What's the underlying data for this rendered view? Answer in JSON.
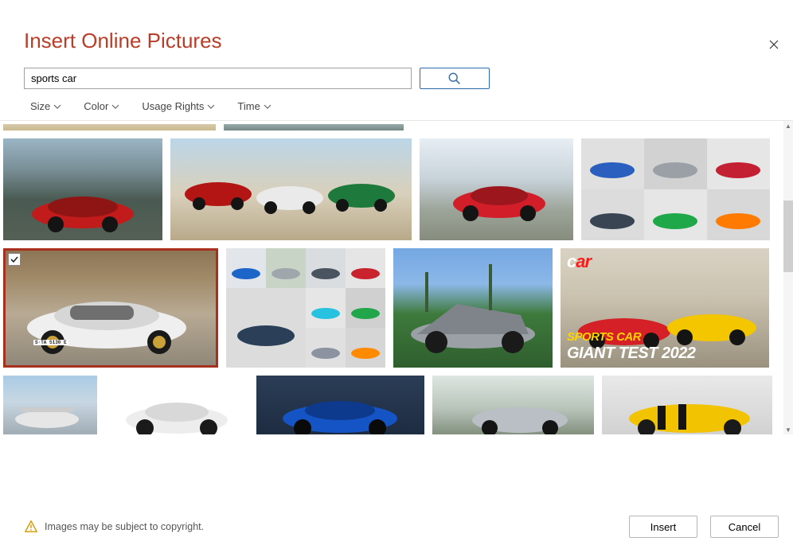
{
  "dialog": {
    "title": "Insert Online Pictures"
  },
  "search": {
    "value": "sports car"
  },
  "filters": {
    "size": "Size",
    "color": "Color",
    "usage_rights": "Usage Rights",
    "time": "Time"
  },
  "footer": {
    "copyright_msg": "Images may be subject to copyright.",
    "insert": "Insert",
    "cancel": "Cancel"
  },
  "overlay": {
    "mag_title_prefix": "c",
    "mag_title_suffix": "ar",
    "line1": "SPORTS CAR",
    "line2": "GIANT TEST 2022"
  },
  "plate_text": "S·TA 5130 E",
  "results": {
    "selected_index": 5,
    "tiles": [
      {
        "desc": "red sports car on coastal road"
      },
      {
        "desc": "three sports cars red white green in desert"
      },
      {
        "desc": "red coupe on track"
      },
      {
        "desc": "grid of six sports cars"
      },
      {
        "desc": "white sports car (selected)"
      },
      {
        "desc": "grid of eight sports cars"
      },
      {
        "desc": "silver concept car on lawn"
      },
      {
        "desc": "magazine cover giant test 2022"
      },
      {
        "desc": "flying car on runway"
      },
      {
        "desc": "white sports car studio"
      },
      {
        "desc": "blue sports car studio"
      },
      {
        "desc": "silver sports car on track curve"
      },
      {
        "desc": "yellow sports car with black stripes"
      }
    ]
  }
}
